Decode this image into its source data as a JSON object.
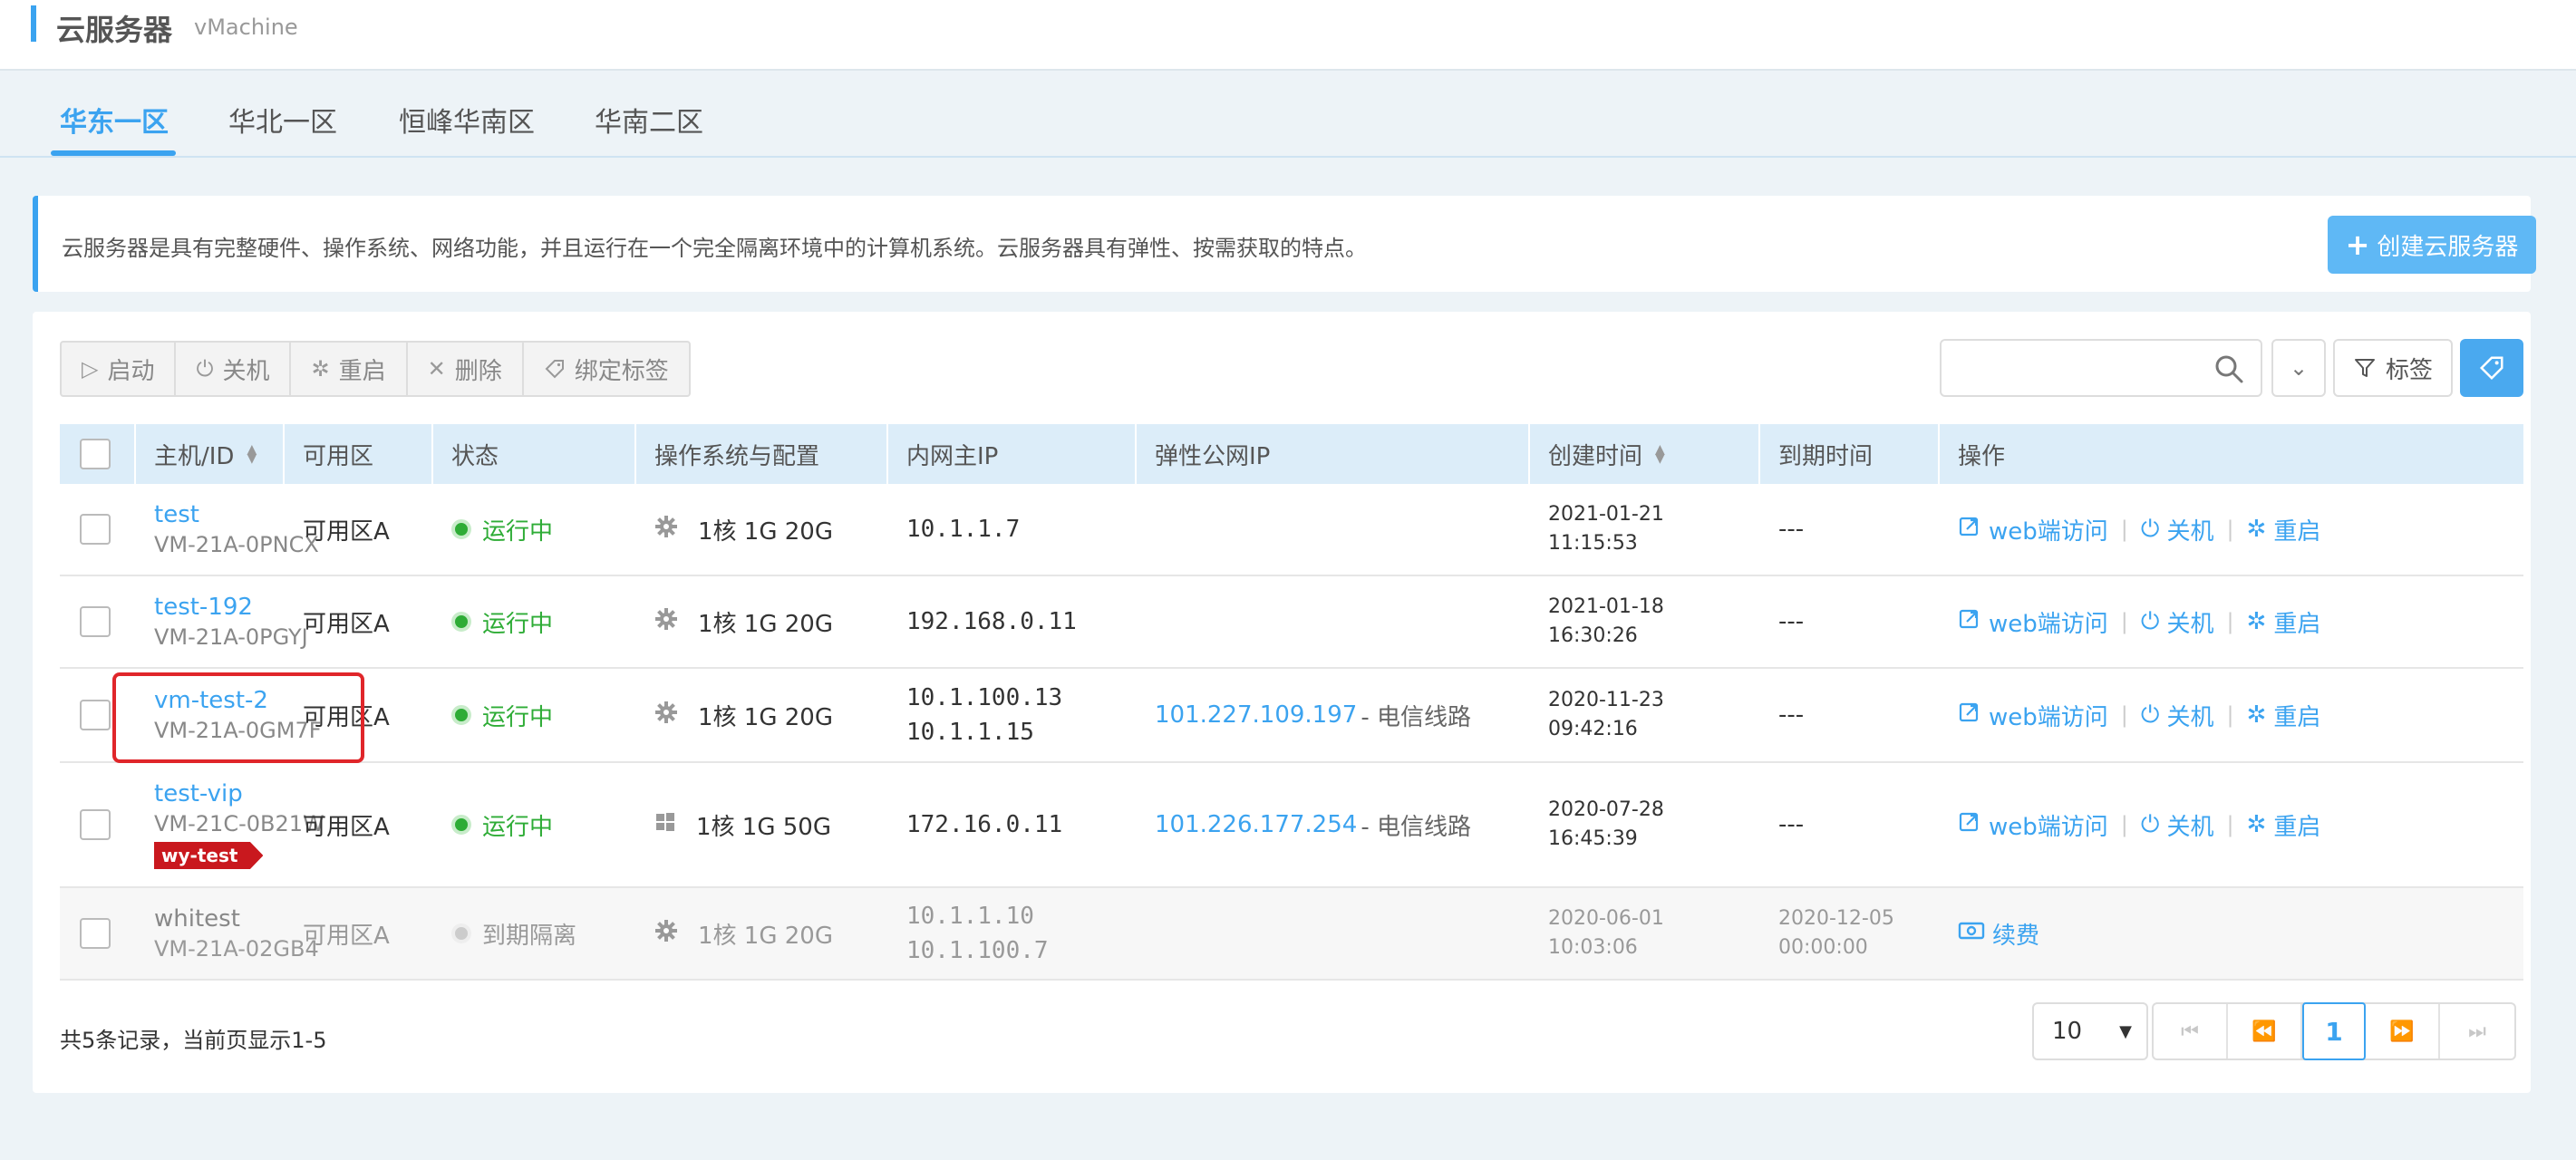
{
  "header": {
    "title": "云服务器",
    "subtitle": "vMachine"
  },
  "tabs": [
    {
      "label": "华东一区",
      "active": true
    },
    {
      "label": "华北一区",
      "active": false
    },
    {
      "label": "恒峰华南区",
      "active": false
    },
    {
      "label": "华南二区",
      "active": false
    }
  ],
  "notice": {
    "text": "云服务器是具有完整硬件、操作系统、网络功能，并且运行在一个完全隔离环境中的计算机系统。云服务器具有弹性、按需获取的特点。",
    "create_label": "创建云服务器"
  },
  "toolbar": {
    "start": "启动",
    "shutdown": "关机",
    "restart": "重启",
    "delete": "删除",
    "bind_tag": "绑定标签"
  },
  "search": {
    "placeholder": ""
  },
  "filters": {
    "tag_label": "标签"
  },
  "table": {
    "columns": {
      "host": "主机/ID",
      "zone": "可用区",
      "status": "状态",
      "os": "操作系统与配置",
      "ip": "内网主IP",
      "eip": "弹性公网IP",
      "created": "创建时间",
      "expire": "到期时间",
      "actions": "操作"
    },
    "rows": [
      {
        "name": "test",
        "id": "VM-21A-0PNCX",
        "zone": "可用区A",
        "status": "运行中",
        "os_icon": "gear-icon",
        "config": "1核 1G 20G",
        "ip1": "10.1.1.7",
        "ip2": "",
        "eip": "",
        "eip_line": "",
        "created_date": "2021-01-21",
        "created_time": "11:15:53",
        "expire": "---"
      },
      {
        "name": "test-192",
        "id": "VM-21A-0PGYJ",
        "zone": "可用区A",
        "status": "运行中",
        "os_icon": "gear-icon",
        "config": "1核 1G 20G",
        "ip1": "192.168.0.11",
        "ip2": "",
        "eip": "",
        "eip_line": "",
        "created_date": "2021-01-18",
        "created_time": "16:30:26",
        "expire": "---"
      },
      {
        "name": "vm-test-2",
        "id": "VM-21A-0GM7F",
        "zone": "可用区A",
        "status": "运行中",
        "os_icon": "gear-icon",
        "config": "1核 1G 20G",
        "ip1": "10.1.100.13",
        "ip2": "10.1.1.15",
        "eip": "101.227.109.197",
        "eip_line": "- 电信线路",
        "created_date": "2020-11-23",
        "created_time": "09:42:16",
        "expire": "---"
      },
      {
        "name": "test-vip",
        "id": "VM-21C-0B21W",
        "tag": "wy-test",
        "zone": "可用区A",
        "status": "运行中",
        "os_icon": "windows-icon",
        "config": "1核 1G 50G",
        "ip1": "172.16.0.11",
        "ip2": "",
        "eip": "101.226.177.254",
        "eip_line": "- 电信线路",
        "created_date": "2020-07-28",
        "created_time": "16:45:39",
        "expire": "---"
      },
      {
        "name": "whitest",
        "id": "VM-21A-02GB4",
        "zone": "可用区A",
        "status": "到期隔离",
        "os_icon": "gear-icon",
        "config": "1核 1G 20G",
        "ip1": "10.1.1.10",
        "ip2": "10.1.100.7",
        "eip": "",
        "eip_line": "",
        "created_date": "2020-06-01",
        "created_time": "10:03:06",
        "expire_date": "2020-12-05",
        "expire_time": "00:00:00"
      }
    ],
    "row_actions": {
      "web": "web端访问",
      "shutdown": "关机",
      "restart": "重启",
      "renew": "续费"
    }
  },
  "footer": {
    "summary": "共5条记录，当前页显示1-5",
    "page_size": "10",
    "current_page": "1"
  },
  "colors": {
    "accent": "#3ba3f0",
    "running": "#2eac36",
    "tag": "#c9181e",
    "highlight": "#e0262a"
  }
}
